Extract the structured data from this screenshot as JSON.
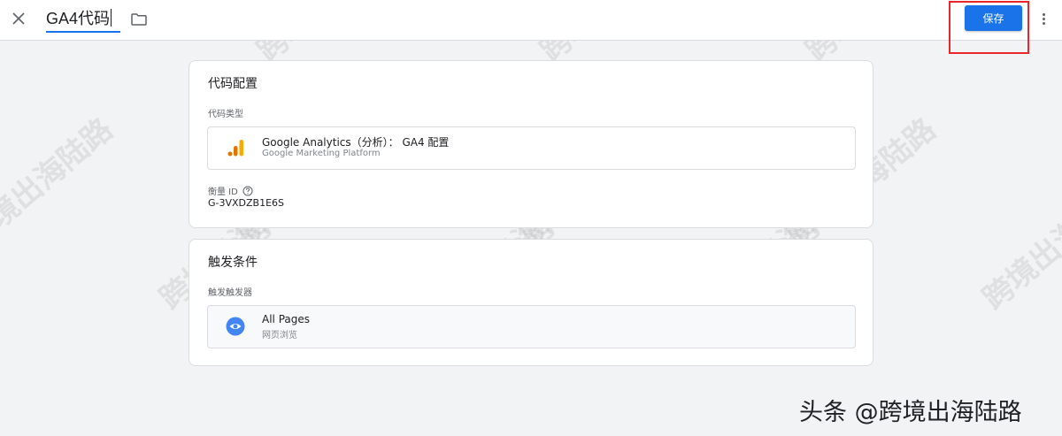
{
  "header": {
    "tag_name": "GA4代码",
    "save_label": "保存"
  },
  "config_card": {
    "title": "代码配置",
    "type_label": "代码类型",
    "tag_type": {
      "name": "Google Analytics（分析）： GA4 配置",
      "platform": "Google Marketing Platform",
      "icon": "google-analytics-icon"
    },
    "measurement_label": "衡量 ID",
    "measurement_id": "G-3VXDZB1E6S"
  },
  "trigger_card": {
    "title": "触发条件",
    "section_label": "触发触发器",
    "trigger": {
      "name": "All Pages",
      "type": "网页浏览",
      "icon": "eye-icon"
    }
  },
  "watermark_text": "跨境出海陆路",
  "source_credit": "头条 @跨境出海陆路",
  "colors": {
    "accent": "#1a73e8",
    "highlight": "#e8262b",
    "analytics_orange": "#f9ab00",
    "analytics_dark_orange": "#e37400",
    "page_bg": "#f1f3f4"
  }
}
